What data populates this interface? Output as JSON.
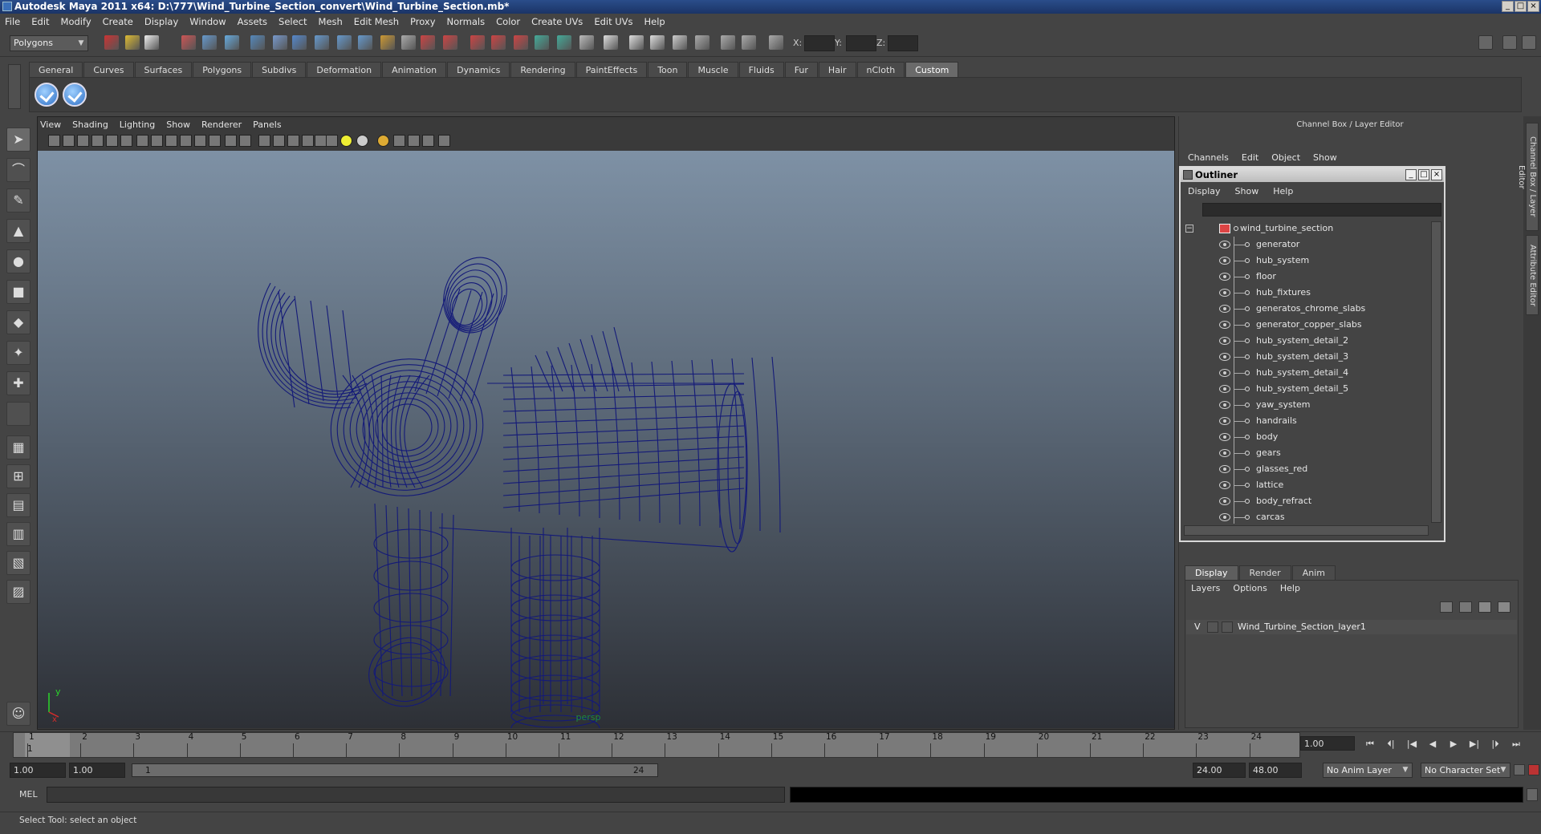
{
  "window": {
    "title": "Autodesk Maya 2011 x64: D:\\777\\Wind_Turbine_Section_convert\\Wind_Turbine_Section.mb*"
  },
  "menu": [
    "File",
    "Edit",
    "Modify",
    "Create",
    "Display",
    "Window",
    "Assets",
    "Select",
    "Mesh",
    "Edit Mesh",
    "Proxy",
    "Normals",
    "Color",
    "Create UVs",
    "Edit UVs",
    "Help"
  ],
  "statusline": {
    "mode": "Polygons",
    "x_label": "X:",
    "y_label": "Y:",
    "z_label": "Z:"
  },
  "shelf": {
    "tabs": [
      "General",
      "Curves",
      "Surfaces",
      "Polygons",
      "Subdivs",
      "Deformation",
      "Animation",
      "Dynamics",
      "Rendering",
      "PaintEffects",
      "Toon",
      "Muscle",
      "Fluids",
      "Fur",
      "Hair",
      "nCloth",
      "Custom"
    ],
    "active_tab": "Custom"
  },
  "viewport": {
    "menu": [
      "View",
      "Shading",
      "Lighting",
      "Show",
      "Renderer",
      "Panels"
    ],
    "camera_label": "persp",
    "axis_y": "y",
    "axis_x": "x",
    "wire_color": "#141a78"
  },
  "channelbox": {
    "title": "Channel Box / Layer Editor",
    "menu": [
      "Channels",
      "Edit",
      "Object",
      "Show"
    ]
  },
  "sidetabs": {
    "channel_box": "Channel Box / Layer Editor",
    "attribute_editor": "Attribute Editor"
  },
  "outliner": {
    "title": "Outliner",
    "menu": [
      "Display",
      "Show",
      "Help"
    ],
    "root": "wind_turbine_section",
    "items": [
      "generator",
      "hub_system",
      "floor",
      "hub_fixtures",
      "generatos_chrome_slabs",
      "generator_copper_slabs",
      "hub_system_detail_2",
      "hub_system_detail_3",
      "hub_system_detail_4",
      "hub_system_detail_5",
      "yaw_system",
      "handrails",
      "body",
      "gears",
      "glasses_red",
      "lattice",
      "body_refract",
      "carcas"
    ]
  },
  "layers": {
    "tabs": [
      "Display",
      "Render",
      "Anim"
    ],
    "active_tab": "Display",
    "menu": [
      "Layers",
      "Options",
      "Help"
    ],
    "visible_flag": "V",
    "layer_name": "Wind_Turbine_Section_layer1"
  },
  "timeline": {
    "ticks": [
      "1",
      "2",
      "3",
      "4",
      "5",
      "6",
      "7",
      "8",
      "9",
      "10",
      "11",
      "12",
      "13",
      "14",
      "15",
      "16",
      "17",
      "18",
      "19",
      "20",
      "21",
      "22",
      "23",
      "24"
    ],
    "current_marker": "1",
    "current_frame": "1.00"
  },
  "range": {
    "start": "1.00",
    "playback_start": "1.00",
    "slider_start": "1",
    "slider_end": "24",
    "playback_end": "24.00",
    "end": "48.00",
    "anim_layer": "No Anim Layer",
    "character_set": "No Character Set"
  },
  "mel": {
    "label": "MEL"
  },
  "help": {
    "text": "Select Tool: select an object"
  }
}
